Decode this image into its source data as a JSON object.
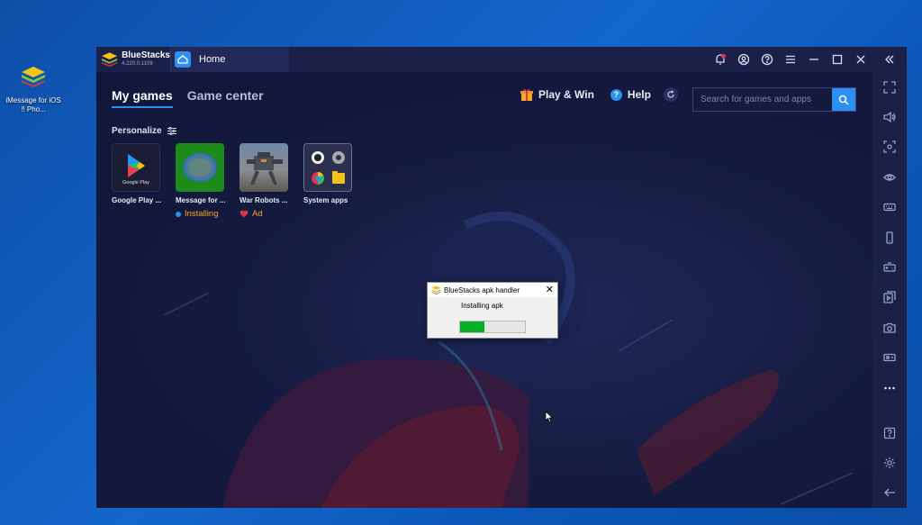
{
  "desktop": {
    "icon_label": "iMessage for iOS !! Pho..."
  },
  "titlebar": {
    "app_name": "BlueStacks",
    "version": "4.220.0.1109",
    "tab_home": "Home",
    "controls": [
      "notification-bell-icon",
      "account-icon",
      "help-circle-icon",
      "menu-icon",
      "minimize-icon",
      "maximize-icon",
      "close-icon",
      "collapse-sidebar-icon"
    ],
    "notification_color": "#e0344c"
  },
  "nav": {
    "tabs": [
      {
        "label": "My games",
        "active": true
      },
      {
        "label": "Game center",
        "active": false
      }
    ]
  },
  "actions": {
    "play_win": "Play & Win",
    "help": "Help",
    "help_glyph": "?"
  },
  "search": {
    "placeholder": "Search for games and apps"
  },
  "personalize": {
    "label": "Personalize"
  },
  "apps": [
    {
      "name": "Google Play ...",
      "icon": "google-play-icon",
      "status": ""
    },
    {
      "name": "Message for ...",
      "icon": "message-app-icon",
      "status": "Installing"
    },
    {
      "name": "War Robots ...",
      "icon": "war-robots-icon",
      "status": "Ad"
    },
    {
      "name": "System apps",
      "icon": "system-apps-icon",
      "status": ""
    }
  ],
  "google_play_caption": "Google Play",
  "dialog": {
    "title": "BlueStacks apk handler",
    "close_glyph": "✕",
    "message": "Installing apk",
    "progress": 0.38
  },
  "sidebar": {
    "items": [
      "fullscreen-icon",
      "volume-icon",
      "screen-resize-icon",
      "eye-icon",
      "keyboard-icon",
      "phone-icon",
      "gamepad-icon",
      "media-manager-icon",
      "camera-icon",
      "record-icon",
      "more-icon",
      "help-square-icon",
      "settings-icon",
      "back-arrow-icon"
    ]
  },
  "colors": {
    "accent": "#2d8ff0",
    "window_bg": "#151a3e",
    "titlebar_bg": "#1b2049",
    "status_orange": "#f5a623",
    "progress_green": "#06b025"
  }
}
